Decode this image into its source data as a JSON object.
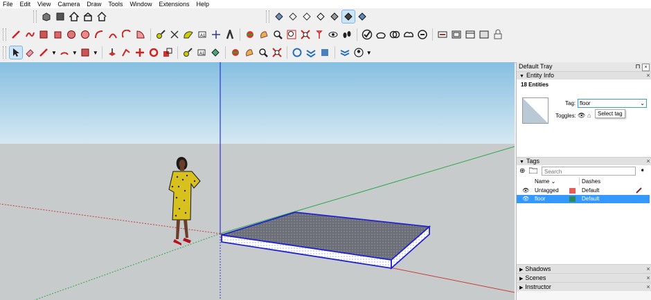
{
  "menu": [
    "File",
    "Edit",
    "View",
    "Camera",
    "Draw",
    "Tools",
    "Window",
    "Extensions",
    "Help"
  ],
  "tray": {
    "title": "Default Tray",
    "entity_info": {
      "header": "Entity Info",
      "count": "18 Entities",
      "tag_label": "Tag:",
      "tag_value": "floor",
      "toggles_label": "Toggles:",
      "tooltip": "Select tag"
    },
    "tags": {
      "header": "Tags",
      "search_placeholder": "Search",
      "col_name": "Name",
      "col_dashes": "Dashes",
      "rows": [
        {
          "name": "Untagged",
          "color": "#e85b5b",
          "dashes": "Default",
          "selected": false
        },
        {
          "name": "floor",
          "color": "#2e8b57",
          "dashes": "Default",
          "selected": true
        }
      ]
    },
    "collapsed": [
      "Shadows",
      "Scenes",
      "Instructor"
    ]
  },
  "colors": {
    "sky": "#8fc3e3",
    "ground": "#c9ccce",
    "selection": "#2222cc",
    "accent": "#3399ff"
  }
}
